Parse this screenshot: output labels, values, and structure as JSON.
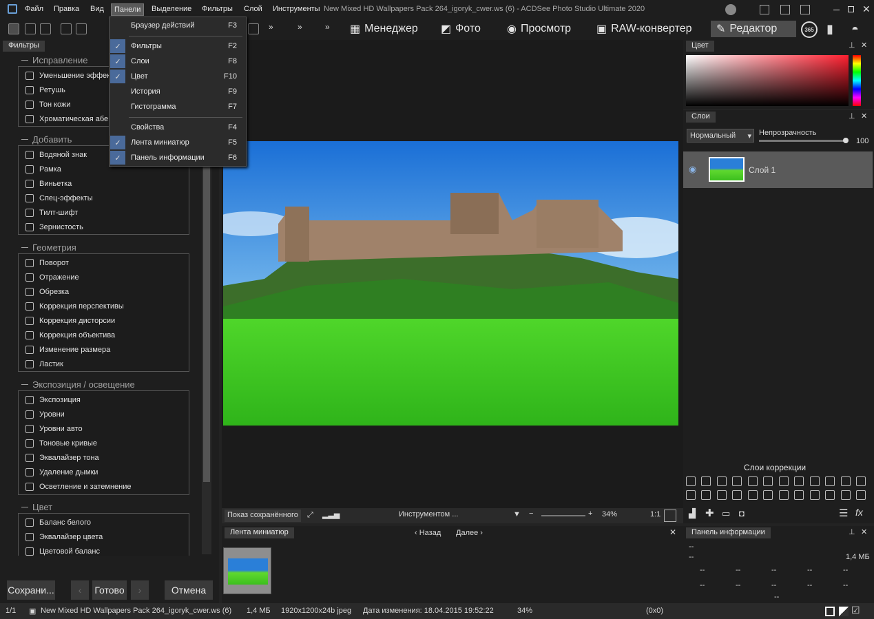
{
  "menu": {
    "items": [
      "Файл",
      "Правка",
      "Вид",
      "Панели",
      "Выделение",
      "Фильтры",
      "Слой",
      "Инструменты"
    ],
    "active": "Панели"
  },
  "window_title": "New Mixed HD Wallpapers Pack 264_igoryk_cwer.ws (6) - ACDSee Photo Studio Ultimate 2020",
  "modes": {
    "manager": "Менеджер",
    "photo": "Фото",
    "view": "Просмотр",
    "raw": "RAW-конвертер",
    "editor": "Редактор",
    "badge": "365"
  },
  "panels_menu": [
    {
      "label": "Браузер действий",
      "key": "F3",
      "checked": false
    },
    {
      "label": "Фильтры",
      "key": "F2",
      "checked": true
    },
    {
      "label": "Слои",
      "key": "F8",
      "checked": true
    },
    {
      "label": "Цвет",
      "key": "F10",
      "checked": true
    },
    {
      "label": "История",
      "key": "F9",
      "checked": false
    },
    {
      "label": "Гистограмма",
      "key": "F7",
      "checked": false
    },
    {
      "label": "Свойства",
      "key": "F4",
      "checked": false
    },
    {
      "label": "Лента миниатюр",
      "key": "F5",
      "checked": true
    },
    {
      "label": "Панель информации",
      "key": "F6",
      "checked": true
    }
  ],
  "filters_tab": "Фильтры",
  "groups": {
    "correction": {
      "title": "Исправление",
      "items": [
        "Уменьшение эффекта",
        "Ретушь",
        "Тон кожи",
        "Хроматическая абе"
      ]
    },
    "add": {
      "title": "Добавить",
      "items": [
        "Водяной знак",
        "Рамка",
        "Виньетка",
        "Спец-эффекты",
        "Тилт-шифт",
        "Зернистость"
      ]
    },
    "geometry": {
      "title": "Геометрия",
      "items": [
        "Поворот",
        "Отражение",
        "Обрезка",
        "Коррекция перспективы",
        "Коррекция дисторсии",
        "Коррекция объектива",
        "Изменение размера",
        "Ластик"
      ]
    },
    "exposure": {
      "title": "Экспозиция / освещение",
      "items": [
        "Экспозиция",
        "Уровни",
        "Уровни авто",
        "Тоновые кривые",
        "Эквалайзер тона",
        "Удаление дымки",
        "Осветление и затемнение"
      ]
    },
    "color": {
      "title": "Цвет",
      "items": [
        "Баланс белого",
        "Эквалайзер цвета",
        "Цветовой баланс"
      ]
    }
  },
  "bottom_buttons": {
    "save": "Сохрани...",
    "done": "Готово",
    "cancel": "Отмена"
  },
  "navbar": {
    "show_saved": "Показ сохранённого",
    "tool": "Инструментом ...",
    "zoom": "34%",
    "ratio": "1:1"
  },
  "filmstrip": {
    "title": "Лента миниатюр",
    "back": "Назад",
    "next": "Далее"
  },
  "color_panel": {
    "title": "Цвет"
  },
  "layers_panel": {
    "title": "Слои",
    "blend_mode": "Нормальный",
    "opacity_label": "Непрозрачность",
    "opacity_value": "100",
    "layer_name": "Слой 1",
    "adjustment_title": "Слои коррекции"
  },
  "info_panel": {
    "title": "Панель информации",
    "line1": "--",
    "line2": "--",
    "size": "1,4 МБ",
    "cell": "--"
  },
  "status": {
    "index": "1/1",
    "file": "New Mixed HD Wallpapers Pack 264_igoryk_cwer.ws (6)",
    "size": "1,4 МБ",
    "dims": "1920x1200x24b jpeg",
    "modified": "Дата изменения: 18.04.2015 19:52:22",
    "zoom": "34%",
    "coords": "(0x0)"
  },
  "colors": {
    "accent": "#4a6a9a",
    "bg": "#1e1e1e",
    "menu_active": "#5a5a5a"
  }
}
